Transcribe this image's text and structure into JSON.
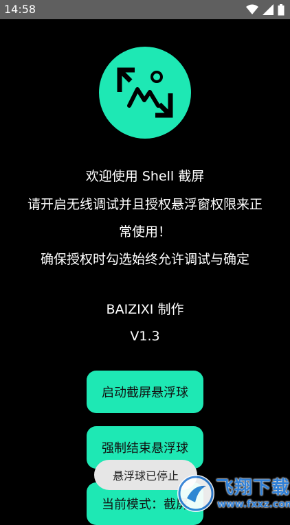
{
  "status_bar": {
    "time": "14:58",
    "icons": [
      "wifi-icon",
      "cellular-icon",
      "battery-icon"
    ]
  },
  "app": {
    "logo_icon": "image-frame-icon",
    "welcome": "欢迎使用 Shell 截屏",
    "instruction_line1": "请开启无线调试并且授权悬浮窗权限来正",
    "instruction_line2": "常使用！",
    "instruction_line3": "确保授权时勾选始终允许调试与确定",
    "author": "BAIZIXI 制作",
    "version": "V1.3"
  },
  "buttons": {
    "start_label": "启动截屏悬浮球",
    "stop_label": "强制结束悬浮球",
    "mode_label": "当前模式：截屏"
  },
  "toast": {
    "message": "悬浮球已停止"
  },
  "watermark": {
    "title": "飞翔下载",
    "domain": "www.fxxz.com"
  },
  "colors": {
    "accent": "#1ee8b4",
    "background": "#000000",
    "status_bar": "#5f5f5f",
    "toast_bg": "#e6e6e6",
    "watermark": "#2f7fd6"
  }
}
